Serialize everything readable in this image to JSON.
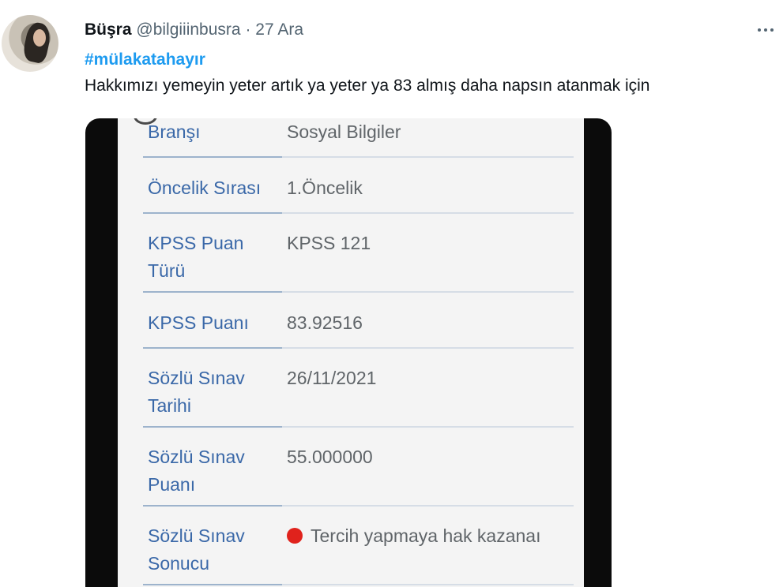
{
  "tweet": {
    "name": "Büşra",
    "handle": "@bilgiiinbusra",
    "separator": "·",
    "date": "27 Ara",
    "hashtag": "#mülakatahayır",
    "text": "Hakkımızı yemeyin yeter artık ya yeter ya 83 almış daha napsın atanmak için"
  },
  "media": {
    "rows": [
      {
        "label": "Branşı",
        "value": "Sosyal Bilgiler"
      },
      {
        "label": "Öncelik Sırası",
        "value": "1.Öncelik"
      },
      {
        "label": "KPSS Puan Türü",
        "value": "KPSS 121"
      },
      {
        "label": "KPSS Puanı",
        "value": "83.92516"
      },
      {
        "label": "Sözlü Sınav Tarihi",
        "value": "26/11/2021"
      },
      {
        "label": "Sözlü Sınav Puanı",
        "value": "55.000000"
      },
      {
        "label": "Sözlü Sınav Sonucu",
        "value": "Tercih yapmaya hak kazanaı",
        "status_color": "#e0221c"
      }
    ]
  },
  "icons": {
    "more": "more-horizontal-icon",
    "status": "red-dot-icon"
  },
  "colors": {
    "link": "#1d9bf0",
    "form_label": "#3a68a8",
    "status_red": "#e0221c"
  }
}
